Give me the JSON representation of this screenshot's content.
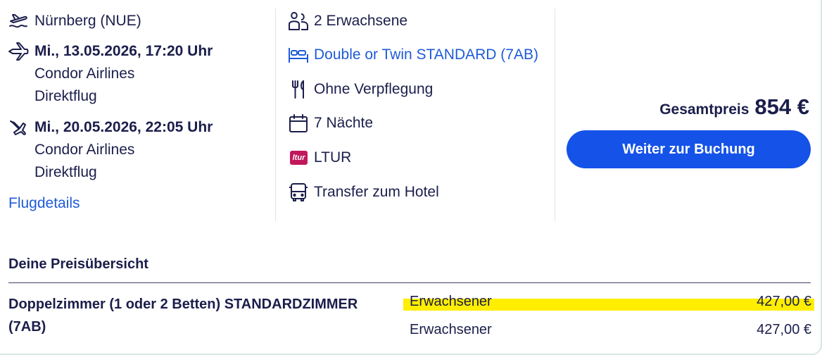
{
  "flight": {
    "departure_airport": "Nürnberg (NUE)",
    "outbound": {
      "datetime": "Mi., 13.05.2026, 17:20 Uhr",
      "airline": "Condor Airlines",
      "type": "Direktflug"
    },
    "return": {
      "datetime": "Mi., 20.05.2026, 22:05 Uhr",
      "airline": "Condor Airlines",
      "type": "Direktflug"
    },
    "details_link": "Flugdetails"
  },
  "hotel": {
    "travellers": "2 Erwachsene",
    "room": "Double or Twin STANDARD (7AB)",
    "board": "Ohne Verpflegung",
    "nights": "7 Nächte",
    "operator_logo_text": "ltur",
    "operator": "LTUR",
    "transfer": "Transfer zum Hotel"
  },
  "summary": {
    "total_label": "Gesamtpreis",
    "total_value": "854 €",
    "book_button": "Weiter zur Buchung"
  },
  "price_overview": {
    "title": "Deine Preisübersicht",
    "room_name": "Doppelzimmer (1 oder 2 Betten) STANDARDZIMMER (7AB)",
    "lines": [
      {
        "label": "Erwachsener",
        "amount": "427,00 €"
      },
      {
        "label": "Erwachsener",
        "amount": "427,00 €"
      }
    ]
  },
  "colors": {
    "accent": "#1452e8",
    "link": "#1e5bd8",
    "text": "#1b1e4b",
    "highlight": "#ffee00",
    "ltur": "#c2185b"
  }
}
